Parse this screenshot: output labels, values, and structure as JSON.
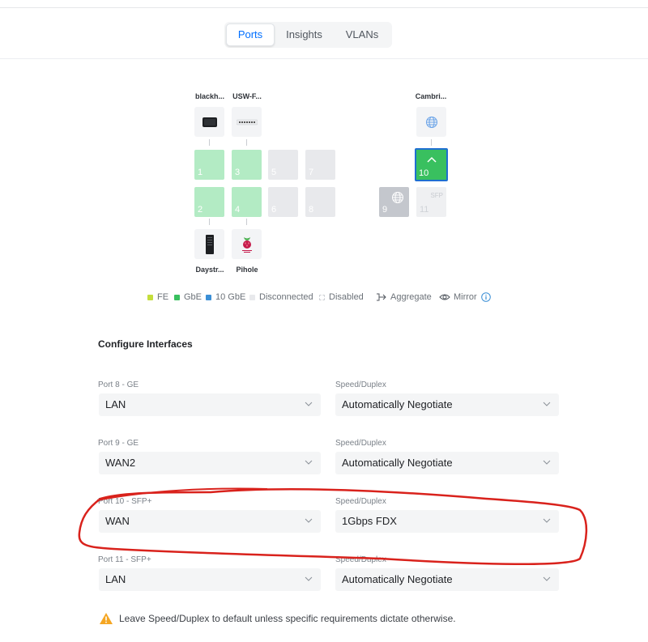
{
  "tabs": [
    {
      "label": "Ports",
      "active": true
    },
    {
      "label": "Insights",
      "active": false
    },
    {
      "label": "VLANs",
      "active": false
    }
  ],
  "devices": {
    "blackhole": {
      "name": "blackh...",
      "icon": "dark-device-icon"
    },
    "usw": {
      "name": "USW-F...",
      "icon": "switch-icon"
    },
    "cambri": {
      "name": "Cambri...",
      "icon": "globe-icon"
    },
    "daystr": {
      "name": "Daystr...",
      "icon": "tower-device-icon"
    },
    "pihole": {
      "name": "Pihole",
      "icon": "raspberry-pi-icon"
    }
  },
  "ports": [
    {
      "number": "1",
      "state": "GbE"
    },
    {
      "number": "2",
      "state": "GbE"
    },
    {
      "number": "3",
      "state": "GbE"
    },
    {
      "number": "4",
      "state": "GbE"
    },
    {
      "number": "5",
      "state": "Disconnected"
    },
    {
      "number": "6",
      "state": "Disconnected"
    },
    {
      "number": "7",
      "state": "Disconnected"
    },
    {
      "number": "8",
      "state": "Disconnected"
    },
    {
      "number": "9",
      "state": "WAN",
      "icon": "globe-icon"
    },
    {
      "number": "10",
      "state": "GbE",
      "selected": true,
      "icon": "chevron-up-icon"
    },
    {
      "number": "11",
      "state": "Disconnected",
      "tag": "SFP"
    }
  ],
  "legend": {
    "fe": "FE",
    "gbe": "GbE",
    "ten_gbe": "10 GbE",
    "disconnected": "Disconnected",
    "disabled": "Disabled",
    "aggregate": "Aggregate",
    "mirror": "Mirror"
  },
  "colors": {
    "fe": "#c4de3c",
    "gbe": "#39c05f",
    "gbe_light": "#b3ebc4",
    "ten_gbe": "#3b8fd6",
    "disconnected": "#e8e9ec",
    "accent": "#006fff",
    "warning": "#f5a623",
    "annotation": "#d9221c"
  },
  "config": {
    "title": "Configure Interfaces",
    "rows": [
      {
        "port_label": "Port 8 - GE",
        "network": "LAN",
        "speed_label": "Speed/Duplex",
        "speed": "Automatically Negotiate"
      },
      {
        "port_label": "Port 9 - GE",
        "network": "WAN2",
        "speed_label": "Speed/Duplex",
        "speed": "Automatically Negotiate"
      },
      {
        "port_label": "Port 10 - SFP+",
        "network": "WAN",
        "speed_label": "Speed/Duplex",
        "speed": "1Gbps FDX"
      },
      {
        "port_label": "Port 11 - SFP+",
        "network": "LAN",
        "speed_label": "Speed/Duplex",
        "speed": "Automatically Negotiate"
      }
    ]
  },
  "warning": {
    "text": "Leave Speed/Duplex to default unless specific requirements dictate otherwise.",
    "icon": "warning-triangle-icon"
  }
}
